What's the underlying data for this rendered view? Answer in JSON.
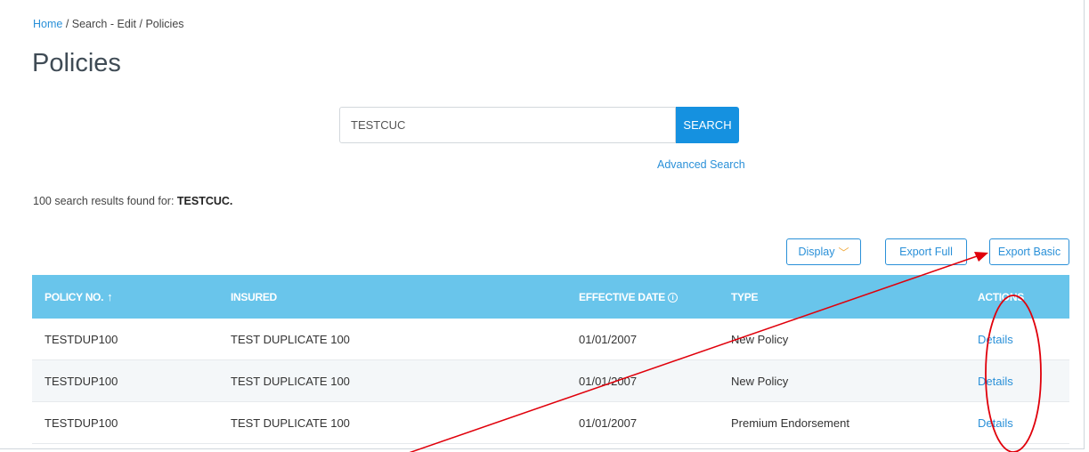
{
  "breadcrumb": {
    "home": "Home",
    "separator1": " / ",
    "search_edit": "Search - Edit",
    "separator2": " / ",
    "current": "Policies"
  },
  "page": {
    "title": "Policies"
  },
  "search": {
    "value": "TESTCUC",
    "button_label": "SEARCH",
    "advanced_link": "Advanced Search"
  },
  "results": {
    "prefix": "100 search results found for: ",
    "term": "TESTCUC."
  },
  "toolbar": {
    "display_label": "Display",
    "export_full_label": "Export Full",
    "export_basic_label": "Export Basic"
  },
  "table": {
    "headers": {
      "policy_no": "POLICY NO.",
      "insured": "INSURED",
      "effective_date": "EFFECTIVE DATE",
      "type": "TYPE",
      "actions": "ACTIONS"
    },
    "rows": [
      {
        "policy_no": "TESTDUP100",
        "insured": "TEST DUPLICATE 100",
        "effective_date": "01/01/2007",
        "type": "New Policy",
        "action": "Details"
      },
      {
        "policy_no": "TESTDUP100",
        "insured": "TEST DUPLICATE 100",
        "effective_date": "01/01/2007",
        "type": "New Policy",
        "action": "Details"
      },
      {
        "policy_no": "TESTDUP100",
        "insured": "TEST DUPLICATE 100",
        "effective_date": "01/01/2007",
        "type": "Premium Endorsement",
        "action": "Details"
      }
    ]
  },
  "colors": {
    "accent": "#1591e0",
    "header_bg": "#69c5eb",
    "link": "#2a90d8",
    "annotation": "#e0000b"
  },
  "icons": {
    "sort": "arrow-up-icon",
    "info": "info-circle-icon",
    "display_chevron": "chevron-down-icon"
  }
}
